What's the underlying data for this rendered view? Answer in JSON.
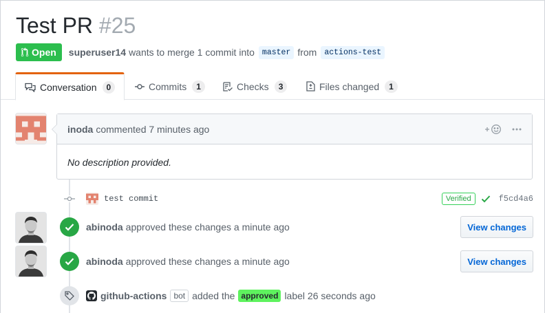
{
  "pr": {
    "title": "Test PR",
    "number": "#25",
    "state": "Open",
    "author": "superuser14",
    "merge_text": "wants to merge 1 commit into",
    "base_branch": "master",
    "from_text": "from",
    "head_branch": "actions-test"
  },
  "tabs": [
    {
      "label": "Conversation",
      "count": "0",
      "icon": "comment-discussion-icon"
    },
    {
      "label": "Commits",
      "count": "1",
      "icon": "git-commit-icon"
    },
    {
      "label": "Checks",
      "count": "3",
      "icon": "checklist-icon"
    },
    {
      "label": "Files changed",
      "count": "1",
      "icon": "file-diff-icon"
    }
  ],
  "comment": {
    "author": "inoda",
    "action": "commented 7 minutes ago",
    "body": "No description provided.",
    "reaction_icon": "smiley-plus-icon",
    "more_icon": "kebab-horizontal-icon"
  },
  "commit": {
    "message": "test commit",
    "verified": "Verified",
    "sha": "f5cd4a6"
  },
  "reviews": [
    {
      "author": "abinoda",
      "text": "approved these changes a minute ago",
      "button": "View changes"
    },
    {
      "author": "abinoda",
      "text": "approved these changes a minute ago",
      "button": "View changes"
    }
  ],
  "label_event": {
    "actor": "github-actions",
    "bot": "bot",
    "pre": "added the",
    "label": "approved",
    "post": "label 26 seconds ago"
  },
  "colors": {
    "open_green": "#2cbe4e",
    "label_green": "#5ef25e",
    "link_blue": "#0366d6",
    "tab_accent": "#e36209"
  }
}
